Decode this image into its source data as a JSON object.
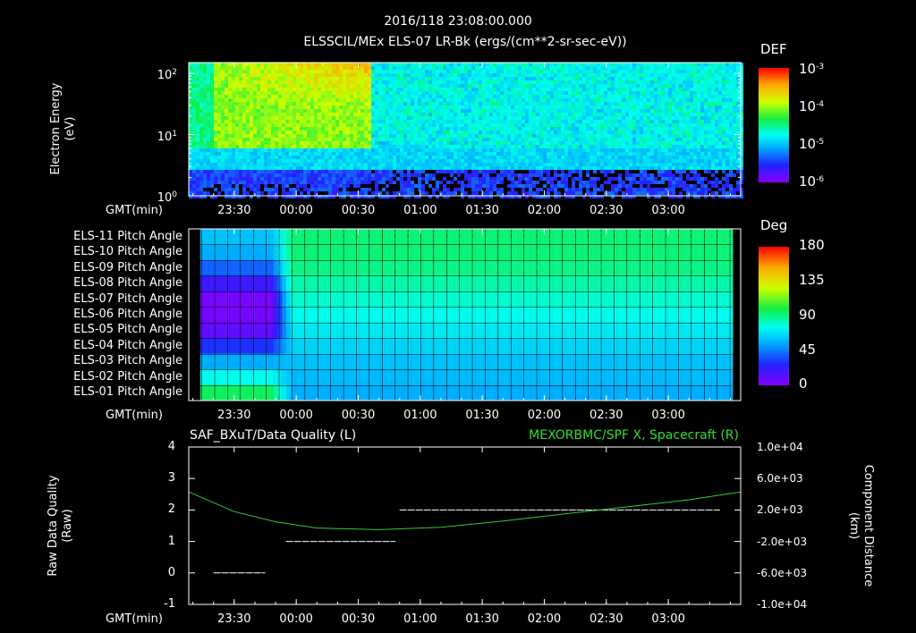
{
  "header": {
    "timestamp": "2016/118 23:08:00.000",
    "title": "ELSSCIL/MEx ELS-07 LR-Bk  (ergs/(cm**2-sr-sec-eV))"
  },
  "colors": {
    "background": "#000000",
    "axis": "#ffffff",
    "quality_line": "#ffffff",
    "spacecraft_line": "#33cc33",
    "right_title": "#33dd33"
  },
  "time_axis": {
    "label": "GMT(min)",
    "ticks": [
      "23:30",
      "00:00",
      "00:30",
      "01:00",
      "01:30",
      "02:00",
      "02:30",
      "03:00"
    ]
  },
  "chart_data": [
    {
      "type": "heatmap",
      "panel": "energy-spectrogram",
      "ylabel_line1": "Electron Energy",
      "ylabel_line2": "(eV)",
      "yscale": "log",
      "ylim": [
        1,
        150
      ],
      "ytick_base": "10",
      "ytick_exponents": [
        "0",
        "1",
        "2"
      ],
      "colorbar": {
        "label": "DEF",
        "scale": "log",
        "range": [
          7e-07,
          0.001
        ],
        "tick_base": "10",
        "tick_exponents": [
          "-3",
          "-4",
          "-5",
          "-6"
        ]
      }
    },
    {
      "type": "heatmap",
      "panel": "pitch-angle",
      "rows": [
        "ELS-11 Pitch Angle",
        "ELS-10 Pitch Angle",
        "ELS-09 Pitch Angle",
        "ELS-08 Pitch Angle",
        "ELS-07 Pitch Angle",
        "ELS-06 Pitch Angle",
        "ELS-05 Pitch Angle",
        "ELS-04 Pitch Angle",
        "ELS-03 Pitch Angle",
        "ELS-02 Pitch Angle",
        "ELS-01 Pitch Angle"
      ],
      "early_values": [
        60,
        55,
        40,
        20,
        5,
        5,
        10,
        30,
        55,
        75,
        95
      ],
      "late_values": [
        92,
        92,
        90,
        85,
        80,
        75,
        70,
        65,
        60,
        58,
        55
      ],
      "transition_time": "23:55",
      "colorbar": {
        "label": "Deg",
        "range": [
          0,
          180
        ],
        "ticks": [
          "180",
          "135",
          "90",
          "45",
          "0"
        ]
      }
    },
    {
      "type": "line",
      "panel": "data-quality",
      "left_title": "SAF_BXuT/Data Quality (L)",
      "right_title": "MEXORBMC/SPF X, Spacecraft (R)",
      "ylabel_left_line1": "Raw Data Quality",
      "ylabel_left_line2": "(Raw)",
      "ylabel_right_line1": "Component Distance",
      "ylabel_right_line2": "(km)",
      "ylim_left": [
        -1,
        4
      ],
      "yticks_left": [
        "4",
        "3",
        "2",
        "1",
        "0",
        "-1"
      ],
      "ylim_right": [
        -10000,
        10000
      ],
      "yticks_right": [
        "1.0e+04",
        "6.0e+03",
        "2.0e+03",
        "-2.0e+03",
        "-6.0e+03",
        "-1.0e+04"
      ],
      "series": [
        {
          "role": "quality",
          "segments": [
            {
              "start": "23:20",
              "end": "23:45",
              "value": 0
            },
            {
              "start": "23:55",
              "end": "00:48",
              "value": 1
            },
            {
              "start": "00:50",
              "end": "03:25",
              "value": 2
            }
          ]
        },
        {
          "role": "spacecraft-x",
          "x": [
            "23:08",
            "23:30",
            "23:50",
            "00:10",
            "00:40",
            "01:10",
            "01:40",
            "02:10",
            "02:40",
            "03:10",
            "03:35"
          ],
          "y": [
            4300,
            1800,
            500,
            -300,
            -500,
            -200,
            600,
            1500,
            2400,
            3300,
            4300
          ]
        }
      ]
    }
  ]
}
